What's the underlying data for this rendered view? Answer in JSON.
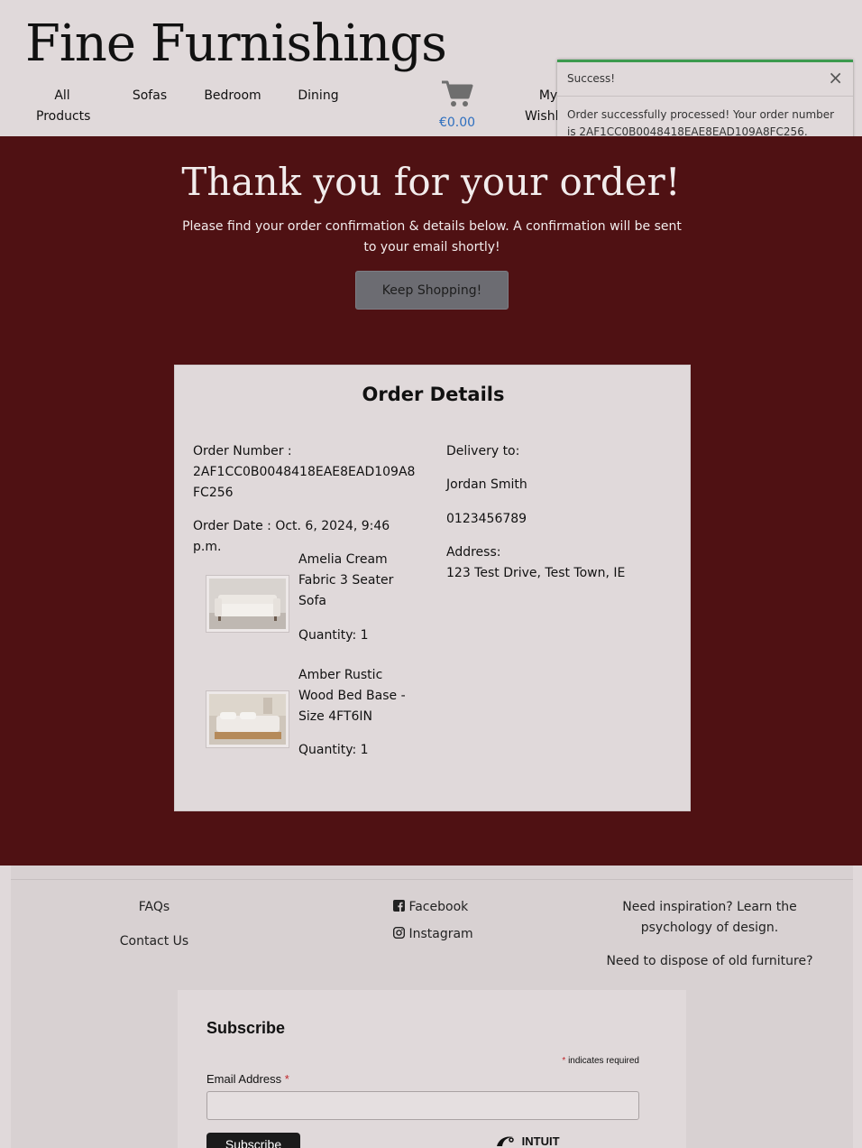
{
  "header": {
    "brand": "Fine Furnishings",
    "nav": {
      "all_products_line1": "All",
      "all_products_line2": "Products",
      "sofas": "Sofas",
      "bedroom": "Bedroom",
      "dining": "Dining",
      "wishlist_line1": "My",
      "wishlist_line2": "Wishl"
    },
    "cart_total": "€0.00",
    "cart_icon": "shopping-cart-icon"
  },
  "toast": {
    "title": "Success!",
    "close_label": "×",
    "message": "Order successfully processed! Your order number is 2AF1CC0B0048418EAE8EAD109A8FC256.",
    "accent_color": "#3c9a4e"
  },
  "hero": {
    "title": "Thank you for your order!",
    "subtitle": "Please find your order confirmation & details below. A confirmation will be sent to your email shortly!",
    "button": "Keep Shopping!",
    "background_color": "#4f1113"
  },
  "order": {
    "title": "Order Details",
    "number_label": "Order Number :",
    "number_value": "2AF1CC0B0048418EAE8EAD109A8FC256",
    "date_label": "Order Date :",
    "date_value": "Oct. 6, 2024, 9:46 p.m.",
    "delivery_label": "Delivery to:",
    "name": "Jordan Smith",
    "phone": "0123456789",
    "address_label": "Address:",
    "address": "123 Test Drive, Test Town, IE",
    "items": [
      {
        "name": "Amelia Cream Fabric 3 Seater Sofa",
        "quantity": "Quantity: 1"
      },
      {
        "name": "Amber Rustic Wood Bed Base - Size 4FT6IN",
        "quantity": "Quantity: 1"
      }
    ]
  },
  "footer": {
    "faqs": "FAQs",
    "contact": "Contact Us",
    "facebook": "Facebook",
    "instagram": "Instagram",
    "inspiration": "Need inspiration? Learn the psychology of design.",
    "dispose": "Need to dispose of old furniture?"
  },
  "subscribe": {
    "title": "Subscribe",
    "required_star": "*",
    "required_note": "indicates required",
    "email_label": "Email Address",
    "button": "Subscribe",
    "intuit": "INTUIT"
  }
}
